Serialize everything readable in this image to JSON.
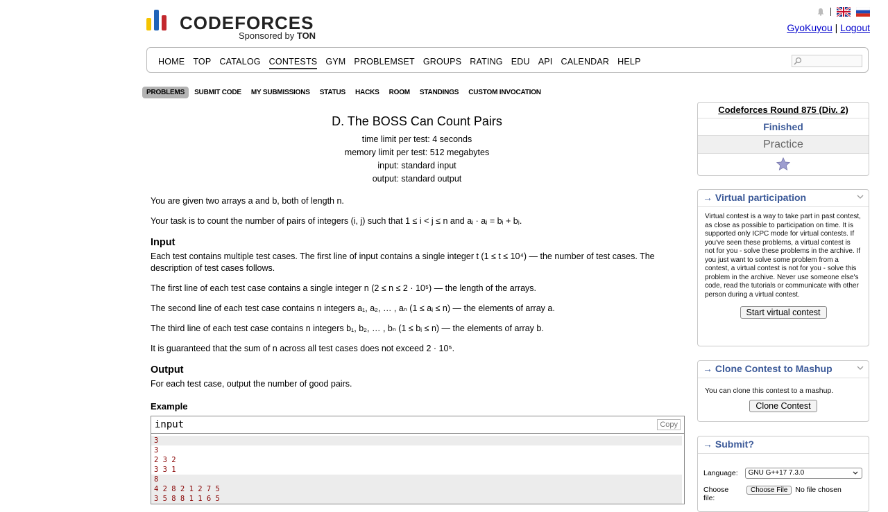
{
  "header": {
    "logo_word": "CODEFORCES",
    "sponsor_prefix": "Sponsored by",
    "sponsor_name": "TON",
    "username": "GyoKuyou",
    "link_sep": "|",
    "logout": "Logout",
    "icons": [
      "bell-icon",
      "uk-flag-icon",
      "russia-flag-icon"
    ]
  },
  "menu": {
    "items": [
      "HOME",
      "TOP",
      "CATALOG",
      "CONTESTS",
      "GYM",
      "PROBLEMSET",
      "GROUPS",
      "RATING",
      "EDU",
      "API",
      "CALENDAR",
      "HELP"
    ],
    "active": "CONTESTS"
  },
  "submenu": {
    "items": [
      "PROBLEMS",
      "SUBMIT CODE",
      "MY SUBMISSIONS",
      "STATUS",
      "HACKS",
      "ROOM",
      "STANDINGS",
      "CUSTOM INVOCATION"
    ],
    "active": "PROBLEMS"
  },
  "problem": {
    "title": "D. The BOSS Can Count Pairs",
    "time_limit": "time limit per test: 4 seconds",
    "memory_limit": "memory limit per test: 512 megabytes",
    "input": "input: standard input",
    "output": "output: standard output",
    "statement_1": "You are given two arrays a and b, both of length n.",
    "statement_2": "Your task is to count the number of pairs of integers (i, j) such that 1 ≤ i < j ≤ n and aᵢ · aⱼ = bᵢ + bⱼ.",
    "input_heading": "Input",
    "input_1": "Each test contains multiple test cases. The first line of input contains a single integer t (1 ≤ t ≤ 10⁴) — the number of test cases. The description of test cases follows.",
    "input_2": "The first line of each test case contains a single integer n (2 ≤ n ≤ 2 · 10⁵) — the length of the arrays.",
    "input_3": "The second line of each test case contains n integers a₁, a₂, … , aₙ (1 ≤ aᵢ ≤ n) — the elements of array a.",
    "input_4": "The third line of each test case contains n integers b₁, b₂, … , bₙ (1 ≤ bᵢ ≤ n) — the elements of array b.",
    "input_5": "It is guaranteed that the sum of n across all test cases does not exceed 2 · 10⁵.",
    "output_heading": "Output",
    "output_1": "For each test case, output the number of good pairs.",
    "example_heading": "Example",
    "sample_label": "input",
    "copy_label": "Copy",
    "sample_lines": [
      "3",
      "3",
      "2 3 2",
      "3 3 1",
      "8",
      "4 2 8 2 1 2 7 5",
      "3 5 8 8 1 1 6 5"
    ]
  },
  "sidebar": {
    "round_title": "Codeforces Round 875 (Div. 2)",
    "round_status": "Finished",
    "practice": "Practice",
    "virtual_heading": "→ Virtual participation",
    "virtual_text": "Virtual contest is a way to take part in past contest, as close as possible to participation on time. It is supported only ICPC mode for virtual contests. If you've seen these problems, a virtual contest is not for you - solve these problems in the archive. If you just want to solve some problem from a contest, a virtual contest is not for you - solve this problem in the archive. Never use someone else's code, read the tutorials or communicate with other person during a virtual contest.",
    "virtual_button": "Start virtual contest",
    "clone_heading": "→ Clone Contest to Mashup",
    "clone_text": "You can clone this contest to a mashup.",
    "clone_button": "Clone Contest",
    "submit_heading": "→ Submit?",
    "language_label": "Language:",
    "language_value": "GNU G++17 7.3.0",
    "choose_label": "Choose file:",
    "choose_button": "Choose File",
    "no_file": "No file chosen"
  }
}
